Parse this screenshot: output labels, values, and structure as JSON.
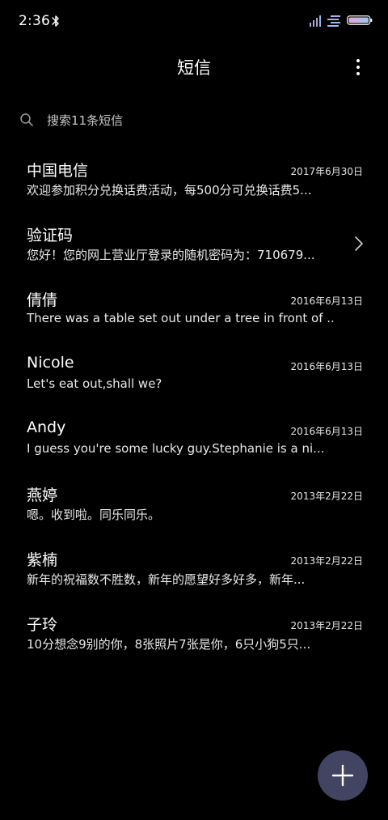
{
  "status_bar": {
    "time": "2:36",
    "icons": [
      "bluetooth-icon",
      "signal-icon",
      "data-icon",
      "battery-icon"
    ]
  },
  "header": {
    "title": "短信",
    "menu_icon": "more-vertical-icon"
  },
  "search": {
    "icon": "search-icon",
    "placeholder": "搜索11条短信"
  },
  "conversations": [
    {
      "name": "中国电信",
      "date": "2017年6月30日",
      "preview": "欢迎参加积分兑换话费活动，每500分可兑换话费5..."
    },
    {
      "name": "验证码",
      "date": "",
      "preview": "您好！您的网上营业厅登录的随机密码为：710679...",
      "icon": "chevron-right-icon"
    },
    {
      "name": "倩倩",
      "date": "2016年6月13日",
      "preview": "There was a table set out under a tree in front of ..."
    },
    {
      "name": "Nicole",
      "date": "2016年6月13日",
      "preview": "Let's eat out,shall we?"
    },
    {
      "name": "Andy",
      "date": "2016年6月13日",
      "preview": "I guess you're some lucky guy.Stephanie is a ni..."
    },
    {
      "name": "燕婷",
      "date": "2013年2月22日",
      "preview": "嗯。收到啦。同乐同乐。"
    },
    {
      "name": "紫楠",
      "date": "2013年2月22日",
      "preview": "新年的祝福数不胜数，新年的愿望好多好多，新年..."
    },
    {
      "name": "子玲",
      "date": "2013年2月22日",
      "preview": "10分想念9别的你，8张照片7张是你，6只小狗5只..."
    }
  ],
  "fab": {
    "icon": "plus-icon",
    "color": "#414562"
  },
  "colors": {
    "background": "#000000",
    "text": "#ffffff",
    "secondary_text": "#c8c8c8",
    "fab": "#414562"
  }
}
